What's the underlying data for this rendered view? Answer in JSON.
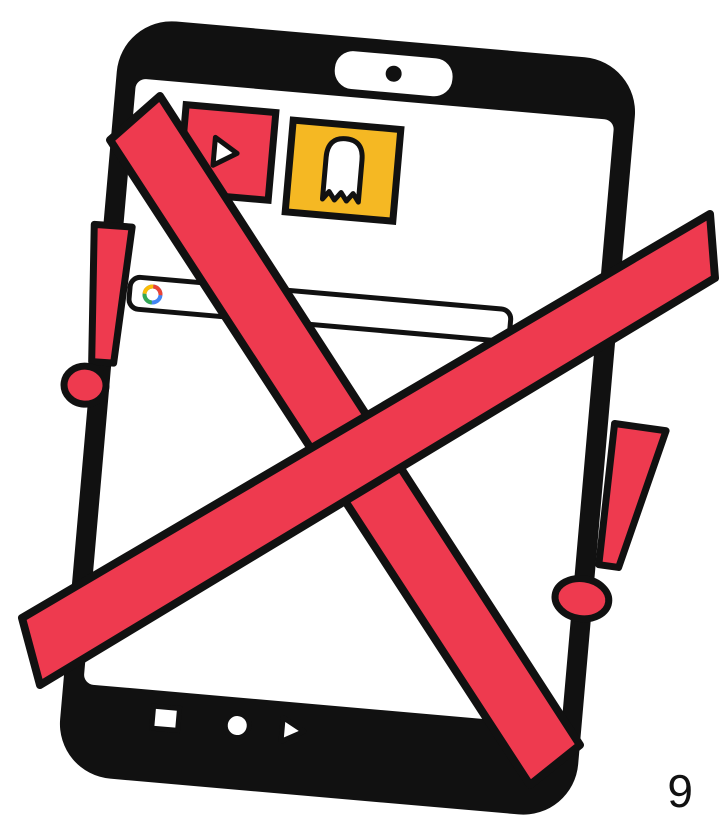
{
  "page": {
    "number": "9"
  },
  "colors": {
    "accent_red": "#ee3a4f",
    "app_yellow": "#f5b823",
    "outline": "#111111",
    "screen": "#ffffff"
  },
  "icons": {
    "app_1": "play-icon",
    "app_2": "ghost-icon",
    "search_bar": "google-logo-icon",
    "nav": [
      "recent-apps-icon",
      "home-icon",
      "back-icon"
    ],
    "overlay": "red-x-icon",
    "warnings": [
      "exclamation-icon",
      "exclamation-icon"
    ]
  }
}
